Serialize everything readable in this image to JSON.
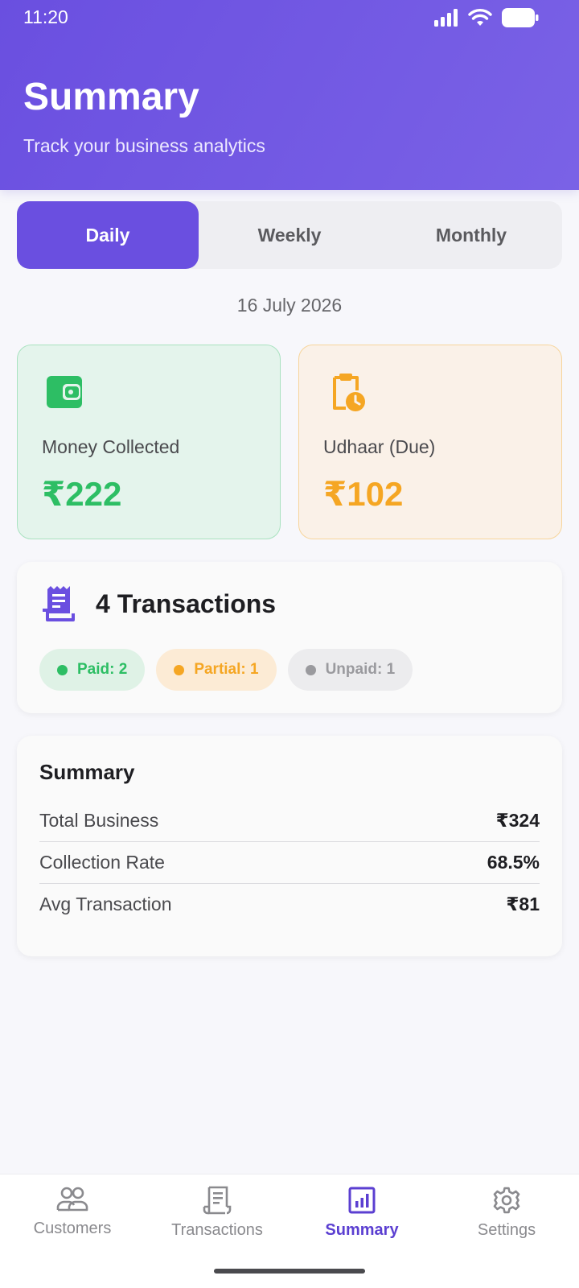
{
  "status": {
    "time": "11:20"
  },
  "header": {
    "title": "Summary",
    "subtitle": "Track your business analytics"
  },
  "tabs": [
    {
      "label": "Daily",
      "active": true
    },
    {
      "label": "Weekly",
      "active": false
    },
    {
      "label": "Monthly",
      "active": false
    }
  ],
  "date": "16 July 2026",
  "stats": {
    "collected": {
      "label": "Money Collected",
      "value": "₹222",
      "icon": "wallet-icon",
      "color": "#2DBE64"
    },
    "due": {
      "label": "Udhaar (Due)",
      "value": "₹102",
      "icon": "clipboard-clock-icon",
      "color": "#F5A623"
    }
  },
  "transactions": {
    "title": "4 Transactions",
    "icon": "receipt-icon",
    "chips": {
      "paid": "Paid: 2",
      "partial": "Partial: 1",
      "unpaid": "Unpaid: 1"
    }
  },
  "summary": {
    "title": "Summary",
    "rows": [
      {
        "label": "Total Business",
        "value": "₹324"
      },
      {
        "label": "Collection Rate",
        "value": "68.5%"
      },
      {
        "label": "Avg Transaction",
        "value": "₹81"
      }
    ]
  },
  "nav": [
    {
      "label": "Customers",
      "icon": "people-icon",
      "active": false
    },
    {
      "label": "Transactions",
      "icon": "receipt-icon",
      "active": false
    },
    {
      "label": "Summary",
      "icon": "bar-chart-icon",
      "active": true
    },
    {
      "label": "Settings",
      "icon": "gear-icon",
      "active": false
    }
  ],
  "colors": {
    "accent": "#6A4FE0",
    "success": "#2DBE64",
    "warning": "#F5A623",
    "muted": "#9A9A9E"
  }
}
